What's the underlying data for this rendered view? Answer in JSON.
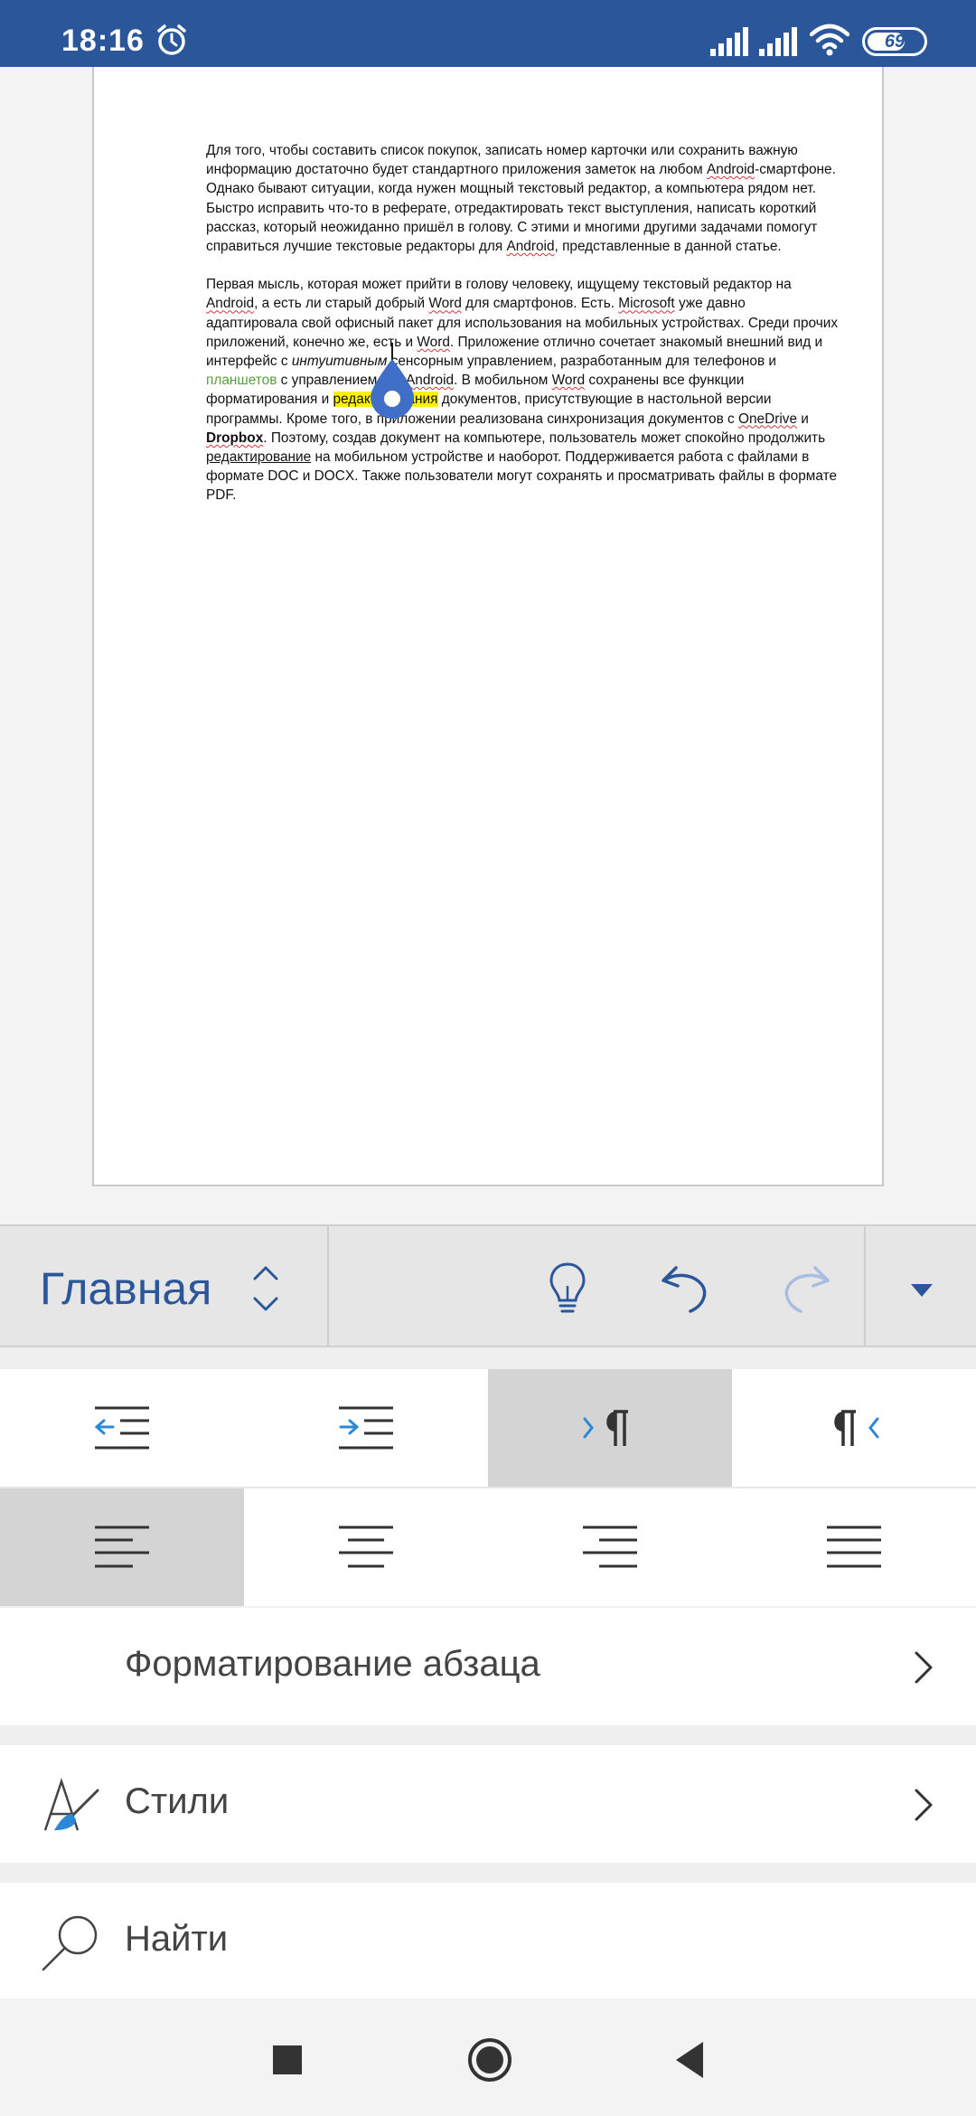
{
  "status_bar": {
    "time": "18:16",
    "battery": "69",
    "battery_level_percent": 69,
    "icons": [
      "alarm-icon",
      "signal-icon",
      "signal-icon",
      "wifi-icon",
      "battery-icon"
    ]
  },
  "document": {
    "paragraph1": {
      "t1": "Для того, чтобы составить список покупок, записать номер карточки или сохранить важную информацию достаточно будет стандартного приложения заметок на любом ",
      "w1": "Android",
      "t2": "-смартфоне. Однако бывают ситуации, когда нужен мощный текстовый редактор, а компьютера рядом нет. Быстро исправить что-то в реферате, отредактировать текст выступления, написать короткий рассказ, который неожиданно пришёл в голову. С этими и многими другими задачами помогут справиться лучшие текстовые редакторы для ",
      "w2": "Android",
      "t3": ", представленные в данной статье."
    },
    "paragraph2": {
      "t1": "Первая мысль, которая может прийти в голову человеку, ищущему текстовый редактор на ",
      "w1": "Android",
      "t2": ", а есть ли старый добрый ",
      "w2": "Word",
      "t3": " для смартфонов. Есть. ",
      "w3": "Microsoft",
      "t4": " уже давно адаптировала свой офисный пакет для использования на мобильных устройствах. Среди прочих приложений, конечно же, есть и ",
      "w4": "Word",
      "t5": ". Приложение отлично сочетает знакомый внешний вид и интерфейс с ",
      "italic": "интуитивным",
      "t6": " сенсорным управлением, разработанным для телефонов и ",
      "green": "планшетов",
      "t7": " с управлением ОС ",
      "w5": "Android",
      "t8": ". В мобильном ",
      "w6": "Word",
      "t9": " сохранены все функции форматирования и ",
      "highlight": "редактирования",
      "t10": " документов, присутствующие в настольной версии программы. Кроме того, в приложении реализована синхронизация документов с ",
      "w7": "OneDrive",
      "t11": " и ",
      "bold": "Dropbox",
      "t12": ". Поэтому, создав документ на компьютере, пользователь может спокойно продолжить ",
      "underlined": "редактирование",
      "t13": " на мобильном устройстве и наоборот. Поддерживается работа с файлами в формате DOC и DOCX. Также пользователи могут сохранять и просматривать файлы в формате PDF."
    }
  },
  "ribbon": {
    "tab_label": "Главная",
    "buttons": [
      "lightbulb-icon",
      "undo-icon",
      "redo-icon",
      "dropdown-icon"
    ]
  },
  "panel": {
    "indent_row": [
      "decrease-indent-icon",
      "increase-indent-icon",
      "ltr-paragraph-icon",
      "rtl-paragraph-icon"
    ],
    "align_row": [
      "align-left-icon",
      "align-center-icon",
      "align-right-icon",
      "justify-icon"
    ],
    "paragraph_formatting": "Форматирование абзаца",
    "styles": "Стили",
    "find": "Найти"
  },
  "colors": {
    "brand_blue": "#2b579a",
    "selected_cell": "#d4d4d4",
    "highlight": "#fff200",
    "spell_error": "#d13438"
  }
}
